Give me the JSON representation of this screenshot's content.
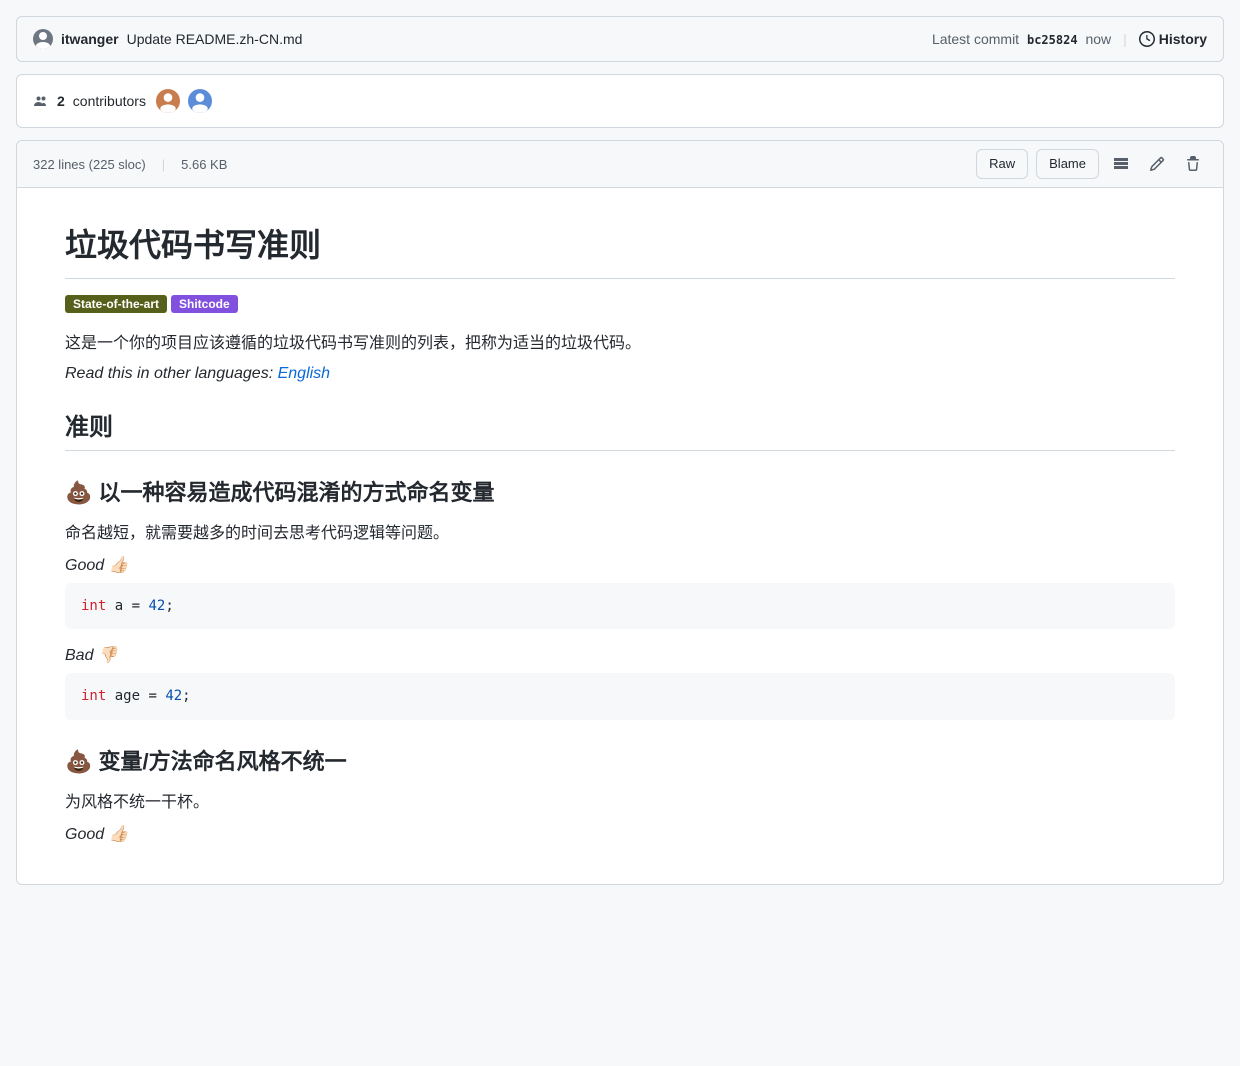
{
  "commit": {
    "author": "itwanger",
    "message": "Update README.zh-CN.md",
    "latest_label": "Latest commit",
    "hash": "bc25824",
    "time": "now",
    "history_label": "History"
  },
  "contributors": {
    "count": "2",
    "label": "contributors"
  },
  "file": {
    "lines": "322 lines (225 sloc)",
    "size": "5.66 KB",
    "raw_label": "Raw",
    "blame_label": "Blame"
  },
  "readme": {
    "title": "垃圾代码书写准则",
    "badges": [
      {
        "text": "State-of-the-art",
        "class": "badge-dark"
      },
      {
        "text": "Shitcode",
        "class": "badge-purple"
      }
    ],
    "description": "这是一个你的项目应该遵循的垃圾代码书写准则的列表，把称为适当的垃圾代码。",
    "other_lang_prefix": "Read this in other languages:",
    "other_lang_link_text": "English",
    "section_title": "准则",
    "rules": [
      {
        "heading": "💩 以一种容易造成代码混淆的方式命名变量",
        "desc": "命名越短，就需要越多的时间去思考代码逻辑等问题。",
        "good_label": "Good 👍🏻",
        "good_code_tokens": [
          {
            "type": "keyword",
            "text": "int"
          },
          {
            "type": "text",
            "text": " a = "
          },
          {
            "type": "number",
            "text": "42"
          },
          {
            "type": "text",
            "text": ";"
          }
        ],
        "bad_label": "Bad 👎🏻",
        "bad_code_tokens": [
          {
            "type": "keyword",
            "text": "int"
          },
          {
            "type": "text",
            "text": " age = "
          },
          {
            "type": "number",
            "text": "42"
          },
          {
            "type": "text",
            "text": ";"
          }
        ]
      },
      {
        "heading": "💩 变量/方法命名风格不统一",
        "desc": "为风格不统一干杯。",
        "good_label": "Good 👍🏻",
        "good_code_tokens": [],
        "bad_label": "",
        "bad_code_tokens": []
      }
    ]
  }
}
